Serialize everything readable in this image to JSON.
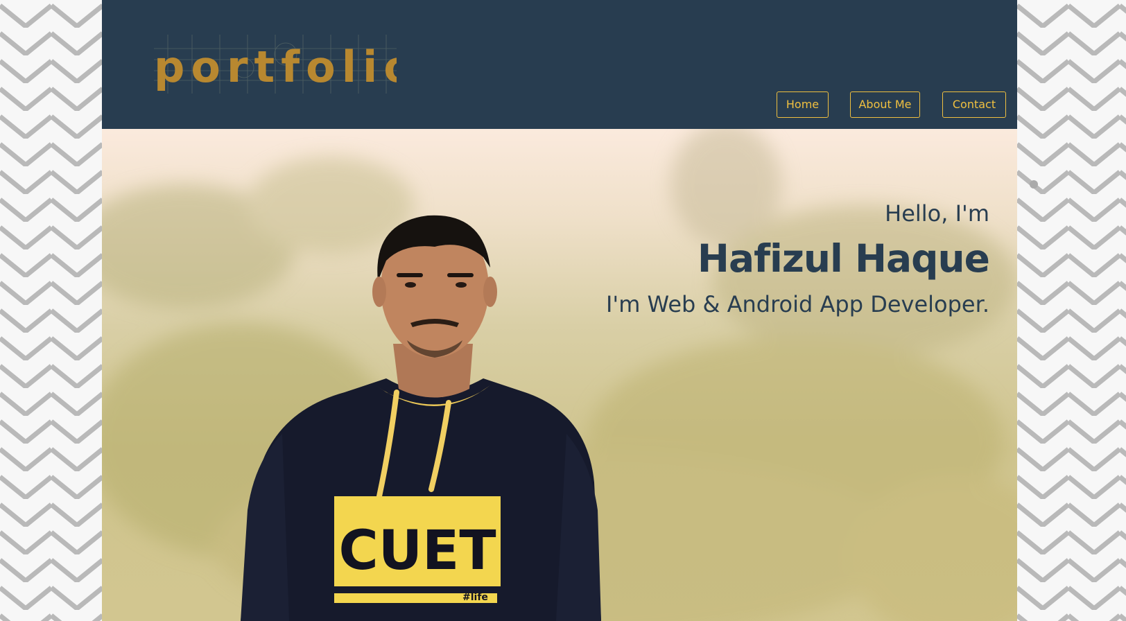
{
  "header": {
    "logo_text": "portfolio",
    "nav": [
      {
        "label": "Home"
      },
      {
        "label": "About Me"
      },
      {
        "label": "Contact"
      }
    ]
  },
  "hero": {
    "greeting": "Hello, I'm",
    "name": "Hafizul Haque",
    "role": "I'm Web & Android App Developer.",
    "shirt_text": "CUET",
    "shirt_tag": "#life"
  },
  "colors": {
    "header_bg": "#283d50",
    "accent": "#f0c040",
    "text_dark": "#283d50",
    "logo": "#b88830"
  }
}
